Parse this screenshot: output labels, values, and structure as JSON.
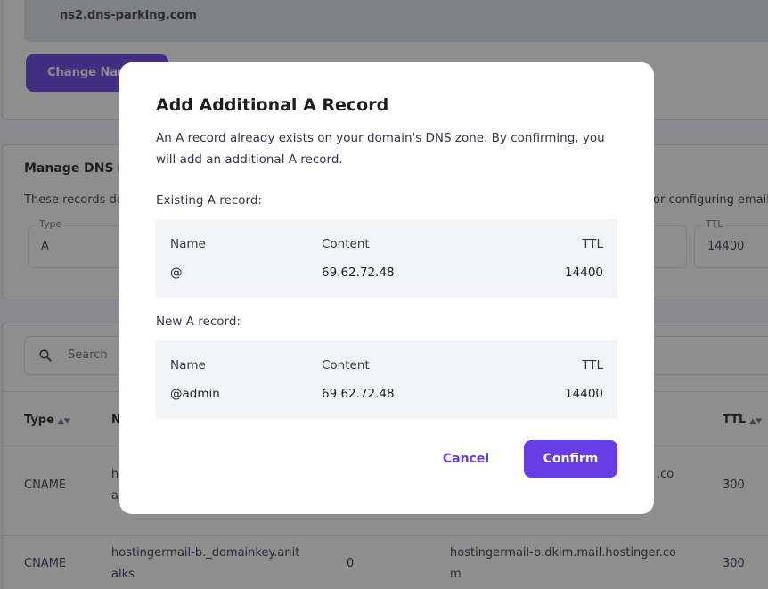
{
  "background": {
    "nameservers": {
      "ns2_value": "ns2.dns-parking.com",
      "change_button_label": "Change Nam"
    },
    "dns": {
      "title": "Manage DNS r",
      "description_left": "These records de",
      "description_right": "or configuring email",
      "type_label": "Type",
      "type_value": "A",
      "ttl_label": "TTL",
      "ttl_value": "14400"
    },
    "records": {
      "search_placeholder": "Search",
      "columns": {
        "type": "Type",
        "name": "N",
        "ttl": "TTL"
      },
      "rows": [
        {
          "type": "CNAME",
          "name_line1": "ho",
          "name_line2": "alk",
          "content_line1": ".co",
          "ttl": "300"
        },
        {
          "type": "CNAME",
          "name_line1": "hostingermail-b._domainkey.anit",
          "name_line2": "alks",
          "priority": "0",
          "content_line1": "hostingermail-b.dkim.mail.hostinger.co",
          "content_line2": "m",
          "ttl": "300"
        }
      ]
    }
  },
  "modal": {
    "title": "Add Additional A Record",
    "description": "An A record already exists on your domain's DNS zone. By confirming, you will add an additional A record.",
    "existing": {
      "label": "Existing A record:",
      "headers": {
        "name": "Name",
        "content": "Content",
        "ttl": "TTL"
      },
      "values": {
        "name": "@",
        "content": "69.62.72.48",
        "ttl": "14400"
      }
    },
    "new": {
      "label": "New A record:",
      "headers": {
        "name": "Name",
        "content": "Content",
        "ttl": "TTL"
      },
      "values": {
        "name": "@admin",
        "content": "69.62.72.48",
        "ttl": "14400"
      }
    },
    "cancel_label": "Cancel",
    "confirm_label": "Confirm"
  },
  "colors": {
    "accent": "#673de6",
    "overlay": "rgba(29,30,32,0.5)",
    "record_bg": "#f2f3f6"
  }
}
